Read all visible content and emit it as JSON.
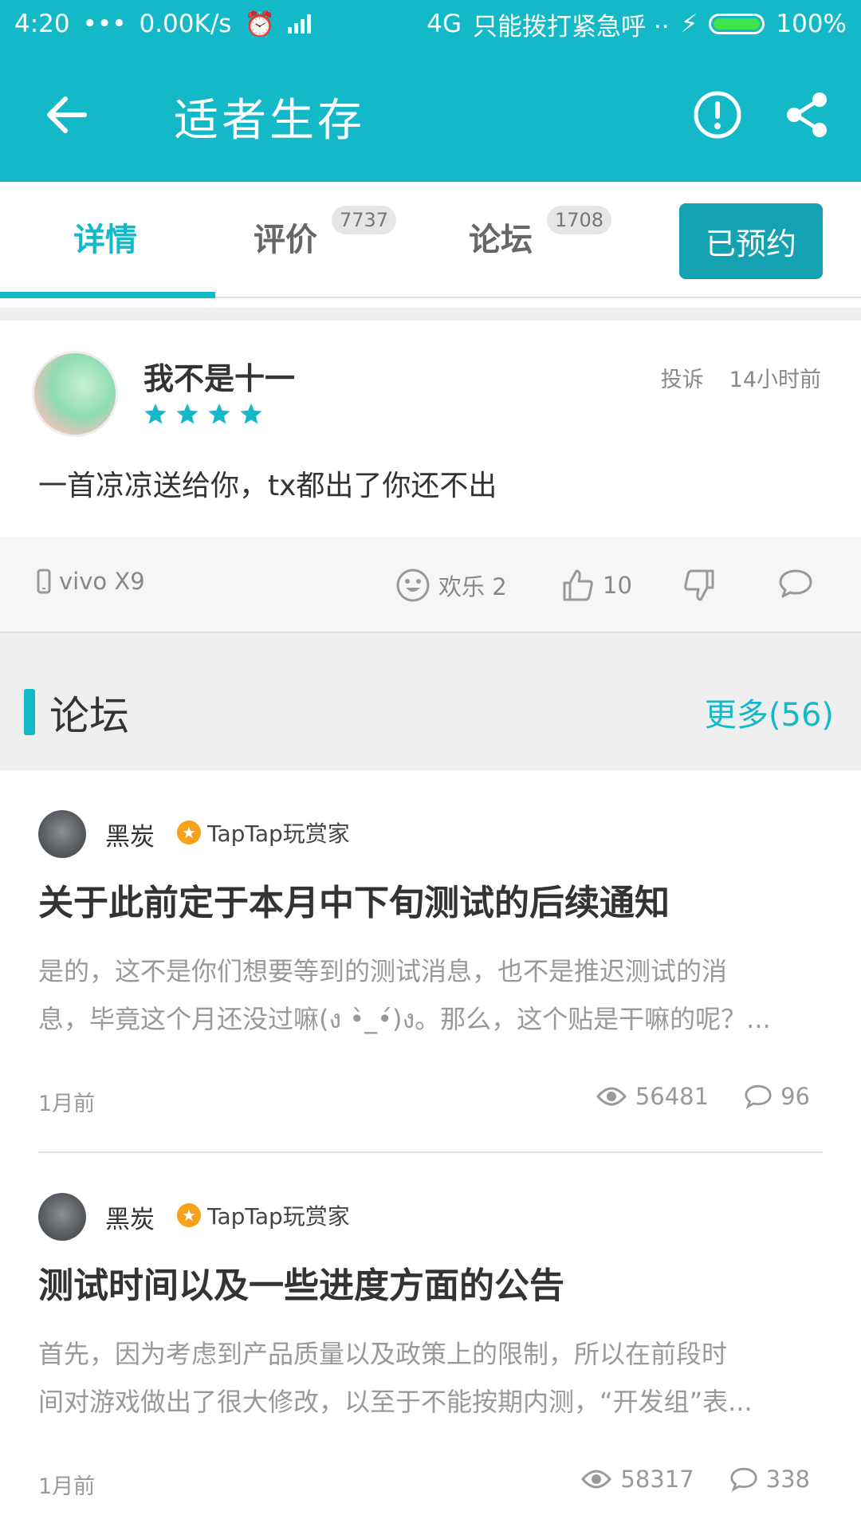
{
  "status_bar": {
    "time": "4:20",
    "net_speed": "0.00K/s",
    "network": "4G",
    "carrier_note": "只能拨打紧急呼 ··",
    "battery": "100%"
  },
  "app_bar": {
    "title": "适者生存",
    "icons": [
      "back-arrow-icon",
      "alert-icon",
      "share-icon"
    ]
  },
  "tabs": [
    {
      "label": "详情",
      "badge": "",
      "active": true
    },
    {
      "label": "评价",
      "badge": "7737",
      "active": false
    },
    {
      "label": "论坛",
      "badge": "1708",
      "active": false
    }
  ],
  "reserve_button": "已预约",
  "review": {
    "user": "我不是十一",
    "rating": 4,
    "report": "投诉",
    "time": "14小时前",
    "text": "一首凉凉送给你，tx都出了你还不出",
    "device": "vivo X9",
    "fun_label": "欢乐 2",
    "likes": "10"
  },
  "forum": {
    "title": "论坛",
    "more": "更多(56)",
    "posts": [
      {
        "author": "黑炭",
        "rank": "TapTap玩赏家",
        "title": "关于此前定于本月中下旬测试的后续通知",
        "excerpt_line1": "是的，这不是你们想要等到的测试消息，也不是推迟测试的消",
        "excerpt_line2": "息，毕竟这个月还没过嘛(ง •̀_•́)ง。那么，这个贴是干嘛的呢？...",
        "time": "1月前",
        "views": "56481",
        "comments": "96"
      },
      {
        "author": "黑炭",
        "rank": "TapTap玩赏家",
        "title": "测试时间以及一些进度方面的公告",
        "excerpt_line1": "首先，因为考虑到产品质量以及政策上的限制，所以在前段时",
        "excerpt_line2": "间对游戏做出了很大修改，以至于不能按期内测，“开发组”表...",
        "time": "1月前",
        "views": "58317",
        "comments": "338"
      }
    ]
  },
  "colors": {
    "accent": "#14b9c8",
    "button": "#14a2b2",
    "medal": "#f7a21b"
  }
}
